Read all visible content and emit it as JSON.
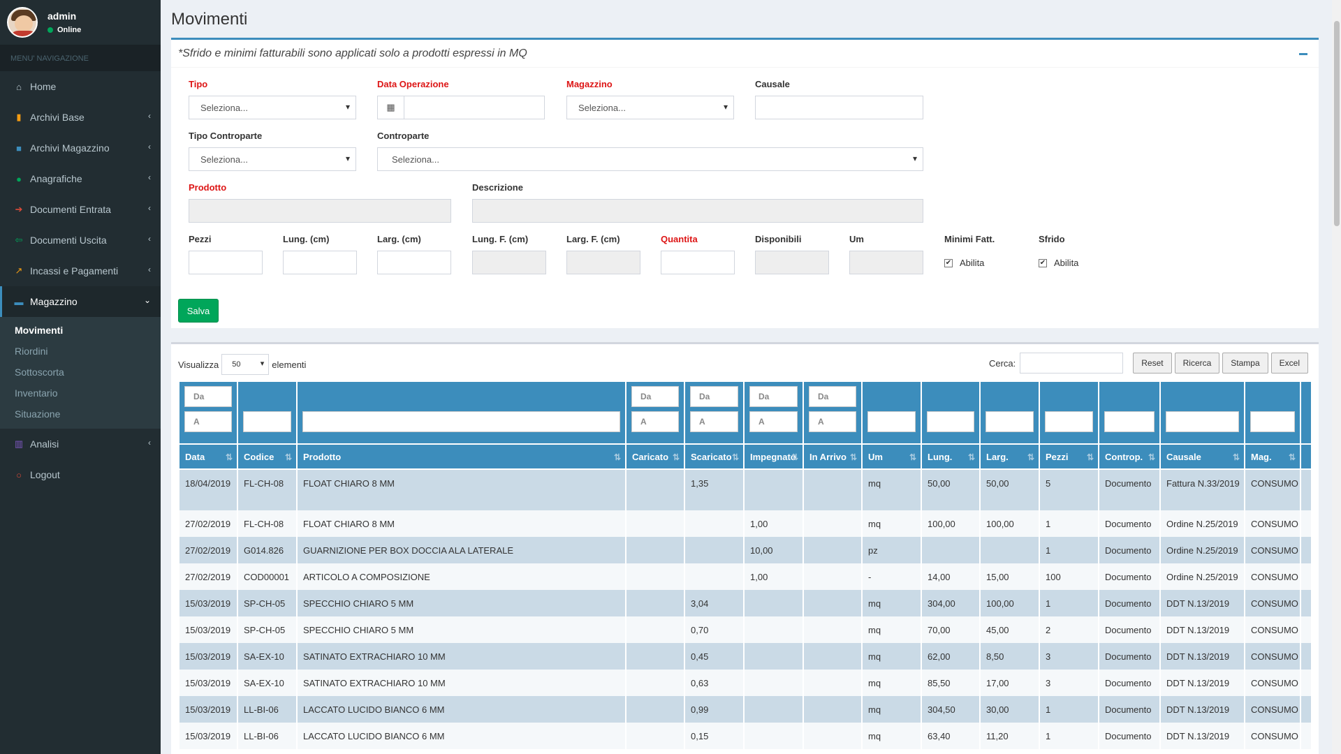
{
  "user": {
    "name": "admin",
    "status": "Online"
  },
  "nav": {
    "header": "MENU' NAVIGAZIONE",
    "items": [
      {
        "label": "Home"
      },
      {
        "label": "Archivi Base"
      },
      {
        "label": "Archivi Magazzino"
      },
      {
        "label": "Anagrafiche"
      },
      {
        "label": "Documenti Entrata"
      },
      {
        "label": "Documenti Uscita"
      },
      {
        "label": "Incassi e Pagamenti"
      },
      {
        "label": "Magazzino"
      },
      {
        "label": "Analisi"
      },
      {
        "label": "Logout"
      }
    ],
    "submenu": [
      "Movimenti",
      "Riordini",
      "Sottoscorta",
      "Inventario",
      "Situazione"
    ]
  },
  "page": {
    "title": "Movimenti"
  },
  "form": {
    "note": "*Sfrido e minimi fatturabili sono applicati solo a prodotti espressi in MQ",
    "tipo_label": "Tipo",
    "tipo_value": "Seleziona...",
    "data_label": "Data Operazione",
    "magazzino_label": "Magazzino",
    "magazzino_value": "Seleziona...",
    "causale_label": "Causale",
    "tipo_contro_label": "Tipo Controparte",
    "tipo_contro_value": "Seleziona...",
    "contro_label": "Controparte",
    "contro_value": "Seleziona...",
    "prodotto_label": "Prodotto",
    "descrizione_label": "Descrizione",
    "pezzi_label": "Pezzi",
    "lung_label": "Lung. (cm)",
    "larg_label": "Larg. (cm)",
    "lungf_label": "Lung. F. (cm)",
    "largf_label": "Larg. F. (cm)",
    "quantita_label": "Quantita",
    "disponibili_label": "Disponibili",
    "um_label": "Um",
    "minimi_label": "Minimi Fatt.",
    "minimi_check": "Abilita",
    "sfrido_label": "Sfrido",
    "sfrido_check": "Abilita",
    "save": "Salva"
  },
  "table": {
    "show_label": "Visualizza",
    "show_value": "50",
    "elements_label": "elementi",
    "search_label": "Cerca:",
    "buttons": [
      "Reset",
      "Ricerca",
      "Stampa",
      "Excel"
    ],
    "filter_da": "Da",
    "filter_a": "A",
    "columns": [
      "Data",
      "Codice",
      "Prodotto",
      "Caricato",
      "Scaricato",
      "Impegnato",
      "In Arrivo",
      "Um",
      "Lung.",
      "Larg.",
      "Pezzi",
      "Controp.",
      "Causale",
      "Mag."
    ],
    "rows": [
      [
        "18/04/2019",
        "FL-CH-08",
        "FLOAT CHIARO 8 MM",
        "",
        "1,35",
        "",
        "",
        "mq",
        "50,00",
        "50,00",
        "5",
        "Documento",
        "Fattura N.33/2019",
        "CONSUMO"
      ],
      [
        "27/02/2019",
        "FL-CH-08",
        "FLOAT CHIARO 8 MM",
        "",
        "",
        "1,00",
        "",
        "mq",
        "100,00",
        "100,00",
        "1",
        "Documento",
        "Ordine N.25/2019",
        "CONSUMO"
      ],
      [
        "27/02/2019",
        "G014.826",
        "GUARNIZIONE PER BOX DOCCIA ALA LATERALE",
        "",
        "",
        "10,00",
        "",
        "pz",
        "",
        "",
        "1",
        "Documento",
        "Ordine N.25/2019",
        "CONSUMO"
      ],
      [
        "27/02/2019",
        "COD00001",
        "ARTICOLO A COMPOSIZIONE",
        "",
        "",
        "1,00",
        "",
        "-",
        "14,00",
        "15,00",
        "100",
        "Documento",
        "Ordine N.25/2019",
        "CONSUMO"
      ],
      [
        "15/03/2019",
        "SP-CH-05",
        "SPECCHIO CHIARO 5 MM",
        "",
        "3,04",
        "",
        "",
        "mq",
        "304,00",
        "100,00",
        "1",
        "Documento",
        "DDT N.13/2019",
        "CONSUMO"
      ],
      [
        "15/03/2019",
        "SP-CH-05",
        "SPECCHIO CHIARO 5 MM",
        "",
        "0,70",
        "",
        "",
        "mq",
        "70,00",
        "45,00",
        "2",
        "Documento",
        "DDT N.13/2019",
        "CONSUMO"
      ],
      [
        "15/03/2019",
        "SA-EX-10",
        "SATINATO EXTRACHIARO 10 MM",
        "",
        "0,45",
        "",
        "",
        "mq",
        "62,00",
        "8,50",
        "3",
        "Documento",
        "DDT N.13/2019",
        "CONSUMO"
      ],
      [
        "15/03/2019",
        "SA-EX-10",
        "SATINATO EXTRACHIARO 10 MM",
        "",
        "0,63",
        "",
        "",
        "mq",
        "85,50",
        "17,00",
        "3",
        "Documento",
        "DDT N.13/2019",
        "CONSUMO"
      ],
      [
        "15/03/2019",
        "LL-BI-06",
        "LACCATO LUCIDO BIANCO 6 MM",
        "",
        "0,99",
        "",
        "",
        "mq",
        "304,50",
        "30,00",
        "1",
        "Documento",
        "DDT N.13/2019",
        "CONSUMO"
      ],
      [
        "15/03/2019",
        "LL-BI-06",
        "LACCATO LUCIDO BIANCO 6 MM",
        "",
        "0,15",
        "",
        "",
        "mq",
        "63,40",
        "11,20",
        "1",
        "Documento",
        "DDT N.13/2019",
        "CONSUMO"
      ]
    ]
  }
}
